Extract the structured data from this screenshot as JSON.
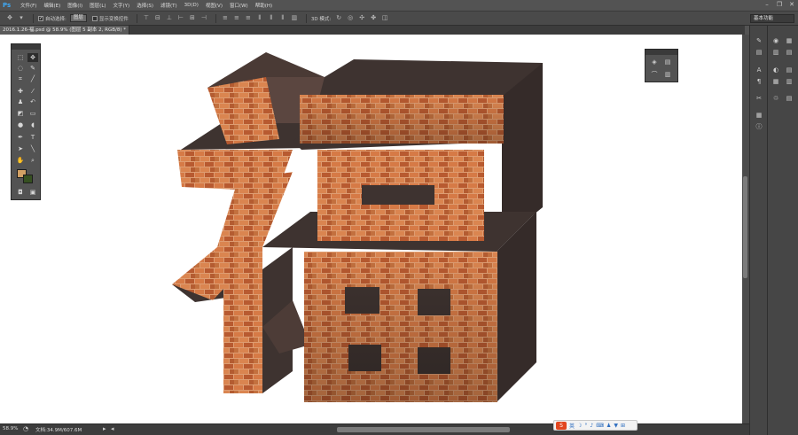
{
  "app": {
    "logo_text": "Ps"
  },
  "menu": {
    "items": [
      "文件(F)",
      "编辑(E)",
      "图像(I)",
      "图层(L)",
      "文字(Y)",
      "选择(S)",
      "滤镜(T)",
      "3D(D)",
      "视图(V)",
      "窗口(W)",
      "帮助(H)"
    ]
  },
  "window_controls": {
    "minimize": "–",
    "restore": "❐",
    "close": "✕"
  },
  "options_bar": {
    "auto_select_label": "自动选择:",
    "auto_select_checked": true,
    "auto_select_value": "图层",
    "show_transform_label": "显示变换控件",
    "mode_3d_label": "3D 模式:",
    "workspace": "基本功能"
  },
  "document": {
    "tab_title": "2016.1.26-福.psd @ 58.9% (图层 5 副本 2, RGB/8) *"
  },
  "status": {
    "zoom": "58.9%",
    "doc_size": "文档:34.9M/607.6M"
  },
  "colors": {
    "foreground": "#d2a165",
    "background": "#365021",
    "canvas": "#ffffff",
    "brick": "#c8683a",
    "shadow_face": "#3e3330"
  },
  "icons": {
    "tools": [
      "move-icon",
      "marquee-icon",
      "lasso-icon",
      "quick-select-icon",
      "crop-icon",
      "eyedropper-icon",
      "healing-icon",
      "brush-icon",
      "stamp-icon",
      "history-brush-icon",
      "eraser-icon",
      "gradient-icon",
      "blur-icon",
      "dodge-icon",
      "pen-icon",
      "type-icon",
      "path-select-icon",
      "shape-icon",
      "hand-icon",
      "zoom-icon",
      "quick-mask-icon",
      "screen-mode-icon"
    ]
  }
}
